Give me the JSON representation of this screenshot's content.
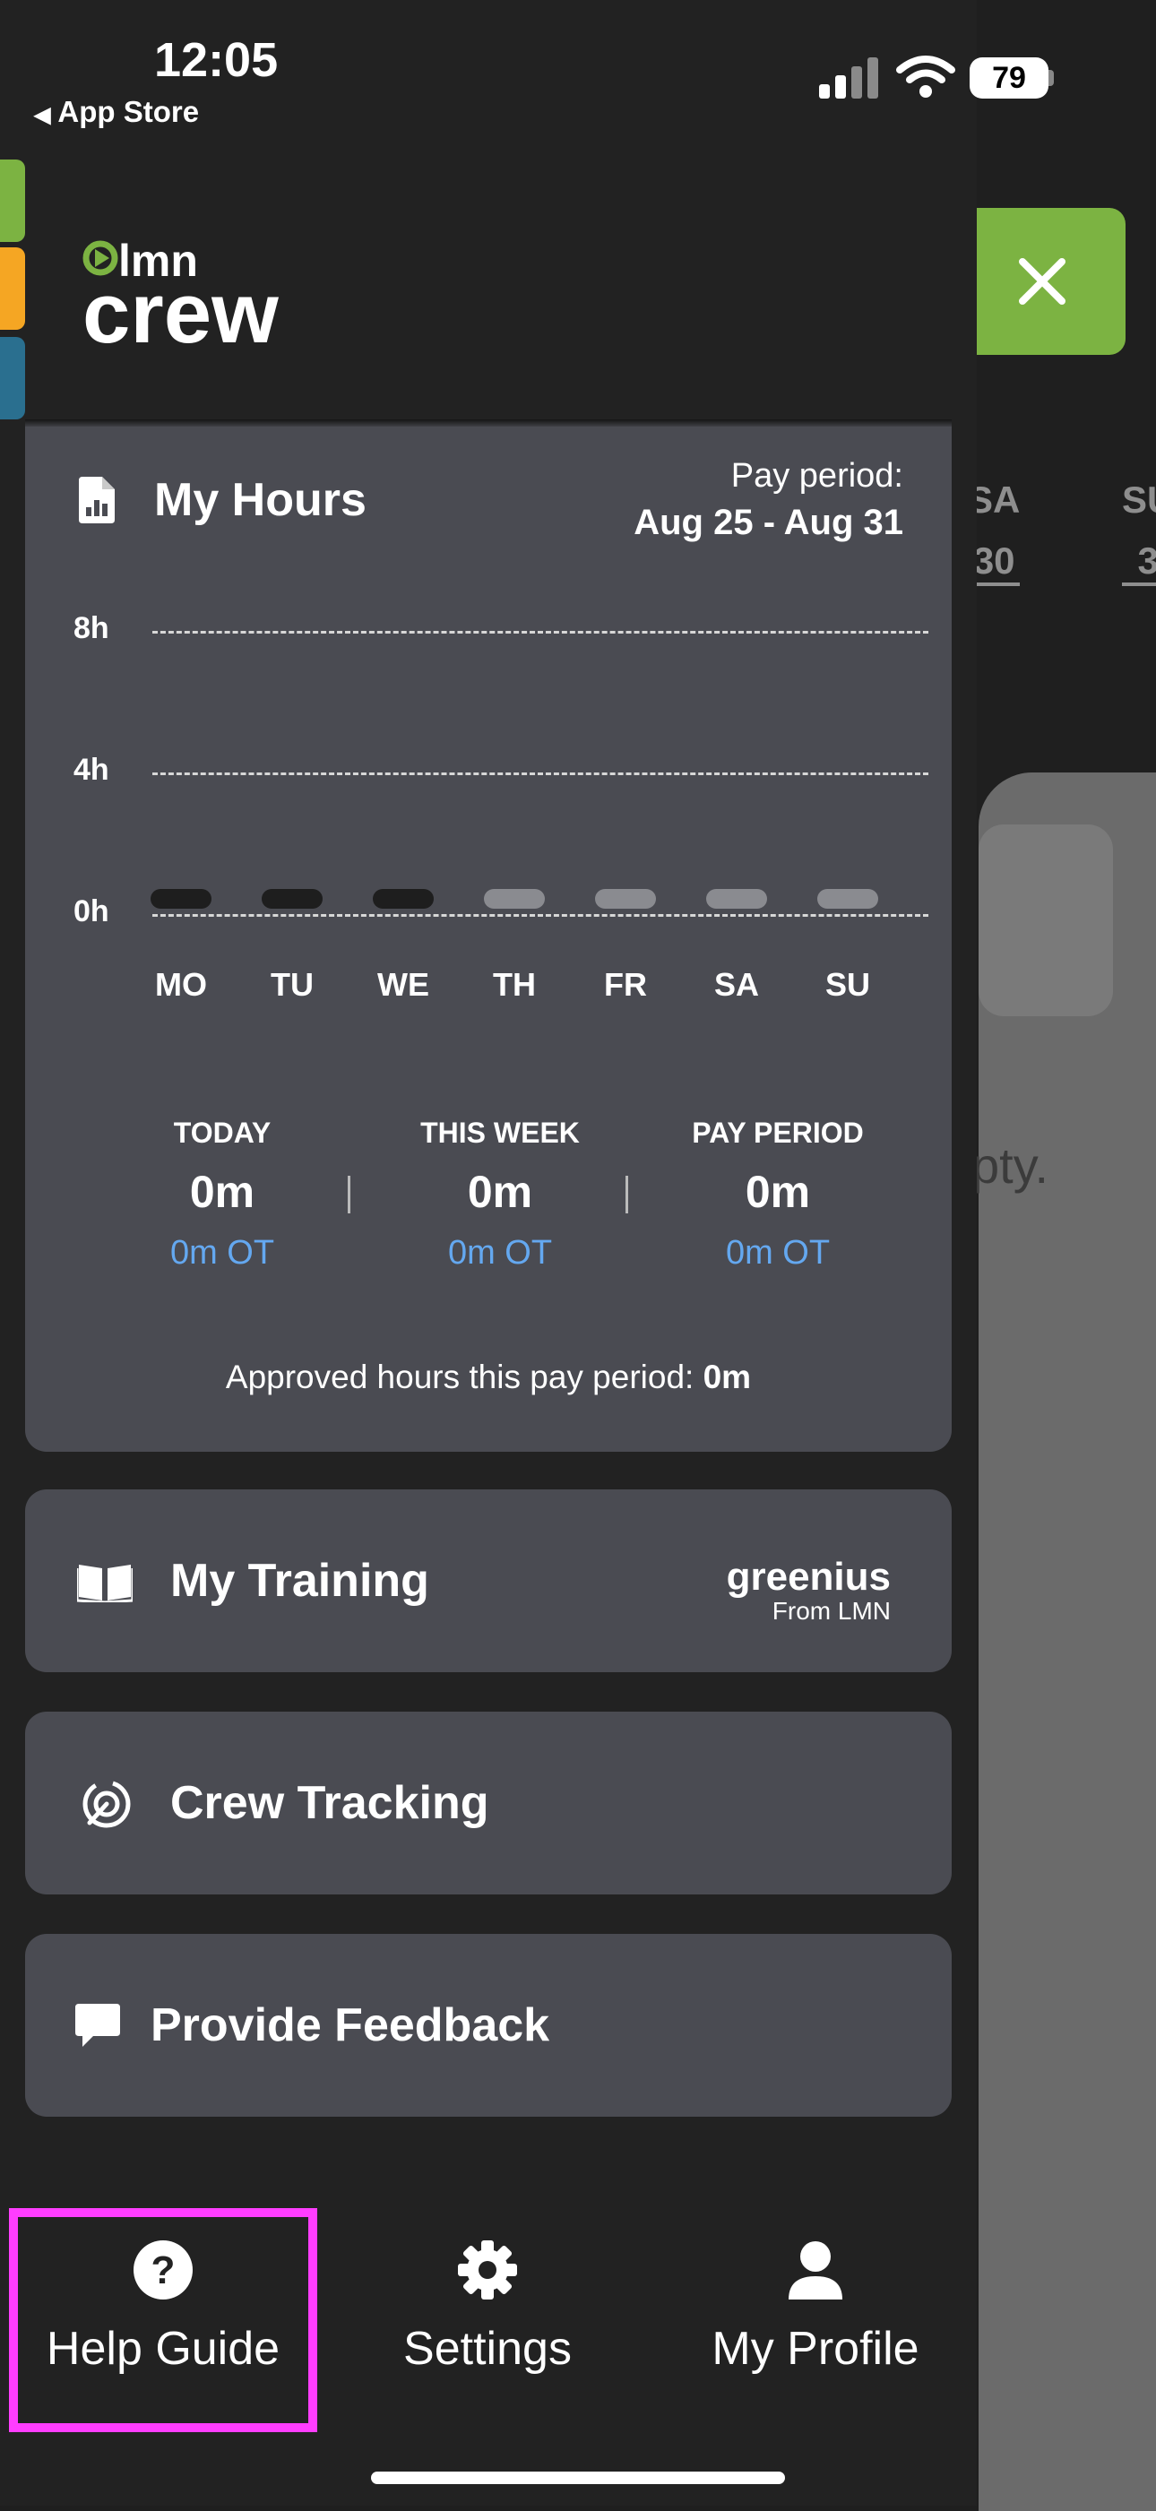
{
  "status_bar": {
    "time": "12:05",
    "back_label": "App Store",
    "battery": "79"
  },
  "background": {
    "days": [
      {
        "abbr": "SA",
        "date": "30"
      },
      {
        "abbr": "SU",
        "date": "3"
      }
    ],
    "partial_text": "pty."
  },
  "hours": {
    "title": "My Hours",
    "pay_period_label": "Pay period:",
    "pay_period_range": "Aug 25 - Aug 31",
    "y_ticks": [
      "8h",
      "4h",
      "0h"
    ],
    "days": [
      "MO",
      "TU",
      "WE",
      "TH",
      "FR",
      "SA",
      "SU"
    ],
    "stats": [
      {
        "label": "TODAY",
        "value": "0m",
        "ot": "0m OT"
      },
      {
        "label": "THIS WEEK",
        "value": "0m",
        "ot": "0m OT"
      },
      {
        "label": "PAY PERIOD",
        "value": "0m",
        "ot": "0m OT"
      }
    ],
    "approved_label": "Approved hours this pay period:",
    "approved_value": "0m"
  },
  "chart_data": {
    "type": "bar",
    "categories": [
      "MO",
      "TU",
      "WE",
      "TH",
      "FR",
      "SA",
      "SU"
    ],
    "values": [
      0,
      0,
      0,
      0,
      0,
      0,
      0
    ],
    "ylim": [
      0,
      8
    ],
    "yticks": [
      "0h",
      "4h",
      "8h"
    ],
    "grid": true
  },
  "menu": {
    "training": "My Training",
    "greenius_brand": "greenius",
    "greenius_sub": "From LMN",
    "tracking": "Crew Tracking",
    "feedback": "Provide Feedback"
  },
  "bottom_nav": [
    {
      "label": "Help Guide",
      "icon": "question-circle-icon"
    },
    {
      "label": "Settings",
      "icon": "gear-icon"
    },
    {
      "label": "My Profile",
      "icon": "person-icon"
    }
  ],
  "colors": {
    "accent_green": "#7cb342",
    "ot_blue": "#64a8f0",
    "highlight": "#ff3dff"
  }
}
